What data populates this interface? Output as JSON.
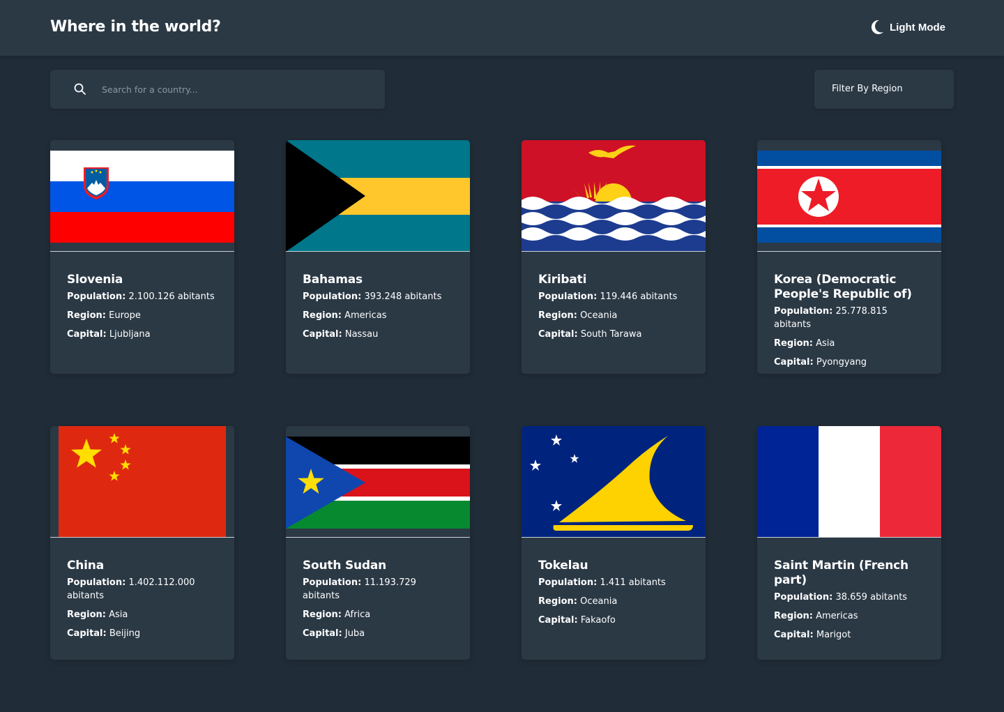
{
  "header": {
    "title": "Where in the world?",
    "mode_label": "Light Mode"
  },
  "search": {
    "placeholder": "Search for a country..."
  },
  "filter": {
    "label": "Filter By Region"
  },
  "labels": {
    "population": "Population:",
    "region": "Region:",
    "capital": "Capital:"
  },
  "countries": [
    {
      "name": "Slovenia",
      "population": "2.100.126 abitants",
      "region": "Europe",
      "capital": "Ljubljana",
      "flag": "slovenia-flag"
    },
    {
      "name": "Bahamas",
      "population": "393.248 abitants",
      "region": "Americas",
      "capital": "Nassau",
      "flag": "bahamas-flag"
    },
    {
      "name": "Kiribati",
      "population": "119.446 abitants",
      "region": "Oceania",
      "capital": "South Tarawa",
      "flag": "kiribati-flag"
    },
    {
      "name": "Korea (Democratic People's Republic of)",
      "population": "25.778.815 abitants",
      "region": "Asia",
      "capital": "Pyongyang",
      "flag": "north-korea-flag"
    },
    {
      "name": "China",
      "population": "1.402.112.000 abitants",
      "region": "Asia",
      "capital": "Beijing",
      "flag": "china-flag"
    },
    {
      "name": "South Sudan",
      "population": "11.193.729 abitants",
      "region": "Africa",
      "capital": "Juba",
      "flag": "south-sudan-flag"
    },
    {
      "name": "Tokelau",
      "population": "1.411 abitants",
      "region": "Oceania",
      "capital": "Fakaofo",
      "flag": "tokelau-flag"
    },
    {
      "name": "Saint Martin (French part)",
      "population": "38.659 abitants",
      "region": "Americas",
      "capital": "Marigot",
      "flag": "saint-martin-flag"
    }
  ],
  "colors": {
    "background": "#202c37",
    "element": "#2b3945",
    "text": "#ffffff"
  }
}
